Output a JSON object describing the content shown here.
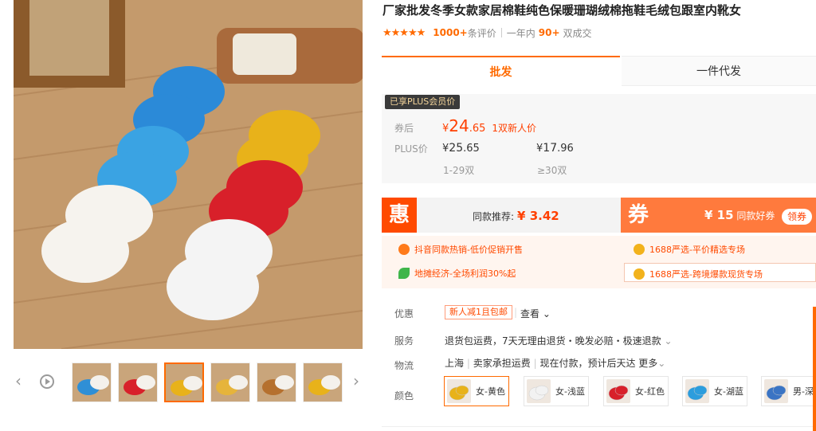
{
  "title": "厂家批发冬季女款家居棉鞋纯色保暖珊瑚绒棉拖鞋毛绒包跟室内靴女",
  "rating": {
    "stars": 5,
    "review_count": "1000+",
    "review_label": "条评价",
    "year_prefix": "一年内",
    "sold_count": "90+",
    "sold_label": "双成交"
  },
  "tabs": {
    "wholesale": "批发",
    "dropship": "一件代发"
  },
  "price": {
    "plus_badge": "已享PLUS会员价",
    "after_coupon_label": "券后",
    "currency": "¥",
    "main_int": "24",
    "main_dec": ".65",
    "main_note": "1双新人价",
    "plus_label": "PLUS价",
    "tier1_int": "25",
    "tier1_dec": ".65",
    "tier2_int": "17",
    "tier2_dec": ".96",
    "tier1_range": "1-29双",
    "tier2_range": "≥30双"
  },
  "promo": {
    "hui": "惠",
    "recommend_label": "同款推荐:",
    "recommend_price": "¥ 3.42",
    "quan": "券",
    "coupon_amount": "¥ 15",
    "coupon_label": "同款好券",
    "get_coupon": "领券",
    "links": [
      "抖音同款热销-低价促销开售",
      "1688严选-平价精选专场",
      "地摊经济-全场利润30%起",
      "1688严选-跨境爆款现货专场"
    ]
  },
  "attrs": {
    "discount_label": "优惠",
    "new_user": "新人减1且包邮",
    "view": "查看",
    "service_label": "服务",
    "service_text": "退货包运费，7天无理由退货・晚发必赔・极速退款",
    "shipping_label": "物流",
    "ship_from": "上海",
    "ship_fee": "卖家承担运费",
    "ship_time": "现在付款，预计后天达",
    "ship_more": "更多",
    "color_label": "颜色"
  },
  "colors": [
    {
      "label": "女-黄色",
      "swatch": "#e8b21a"
    },
    {
      "label": "女-浅蓝",
      "swatch": "#f2f2f2"
    },
    {
      "label": "女-红色",
      "swatch": "#d8202a"
    },
    {
      "label": "女-湖蓝",
      "swatch": "#2c9ddd"
    },
    {
      "label": "男-深",
      "swatch": "#3a74c4"
    }
  ],
  "thumb_colors": [
    "#2f8fd6",
    "#d8202a",
    "#e8b21a",
    "#e6b43b",
    "#b5702e",
    "#e8b21a"
  ]
}
